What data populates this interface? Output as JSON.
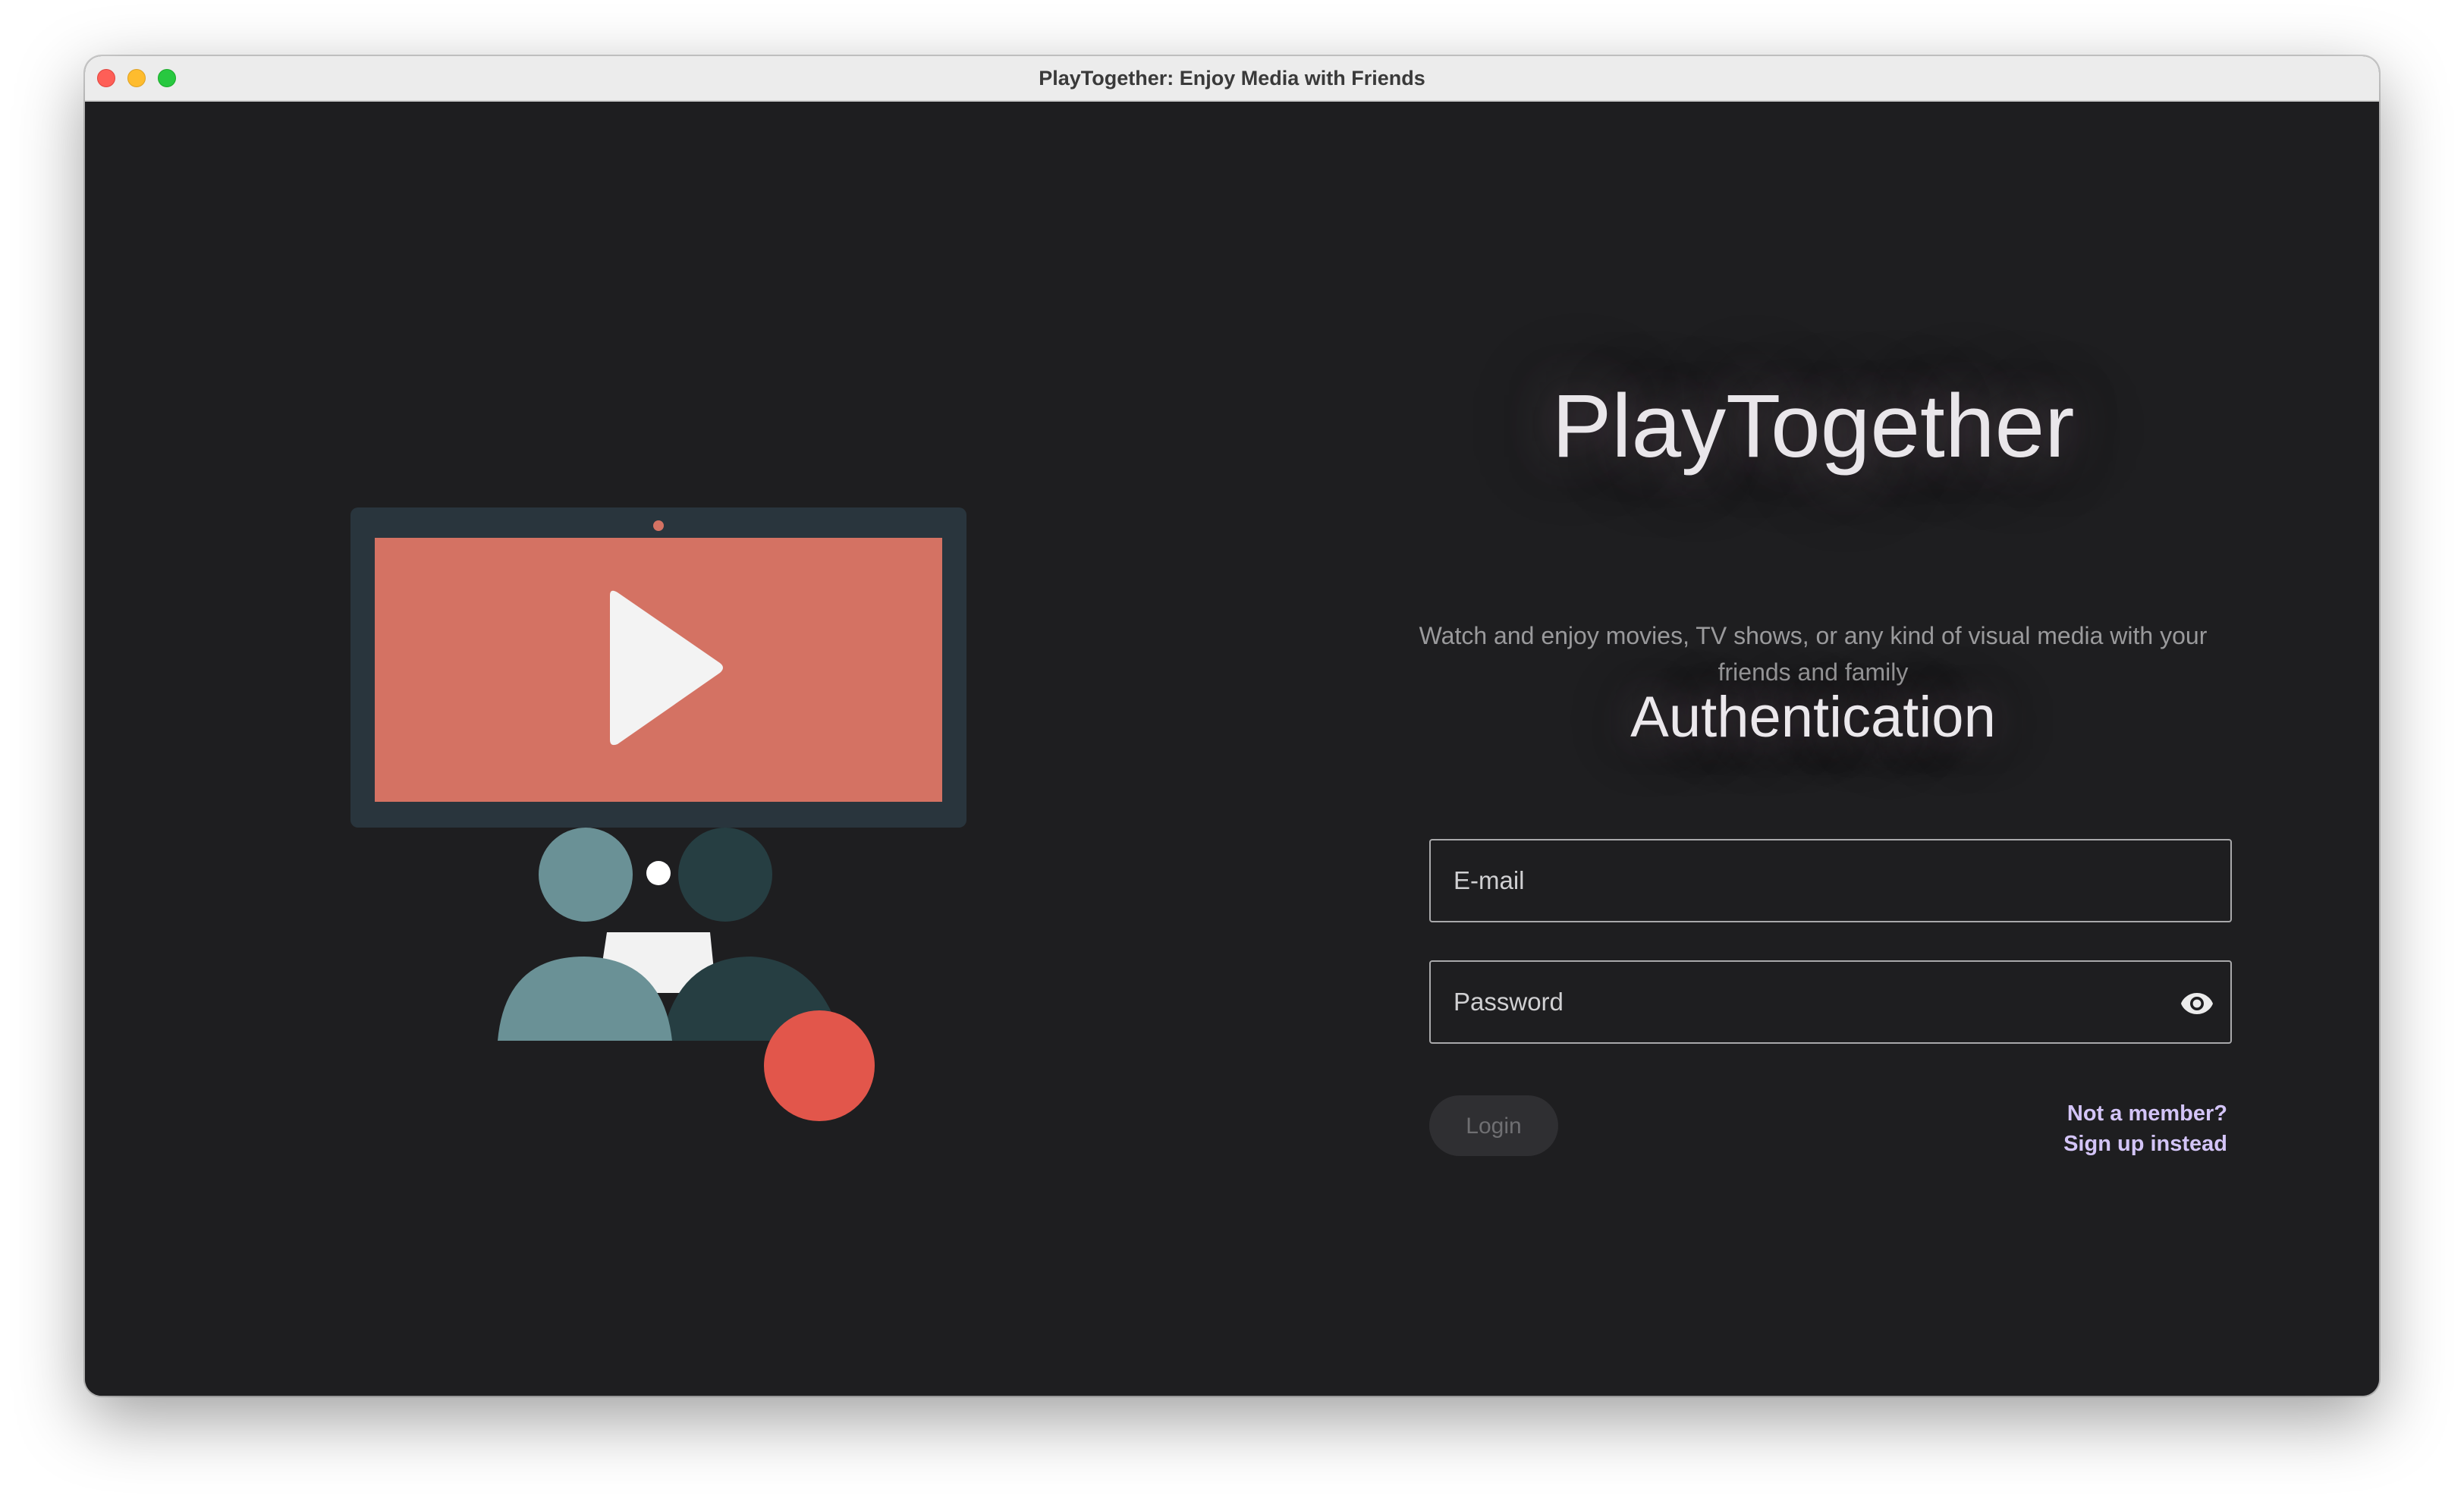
{
  "window": {
    "title": "PlayTogether: Enjoy Media with Friends"
  },
  "hero": {
    "app_name": "PlayTogether",
    "tagline": "Watch and enjoy movies, TV shows, or any kind of visual media with your friends and family",
    "section_title": "Authentication"
  },
  "form": {
    "email_placeholder": "E-mail",
    "password_placeholder": "Password",
    "password_toggle_icon": "eye-icon",
    "login_label": "Login",
    "signup_line1": "Not a member?",
    "signup_line2": "Sign up instead"
  },
  "colors": {
    "background": "#1e1e20",
    "screen": "#d47263",
    "monitor_frame": "#29353d",
    "person_light": "#6a9196",
    "person_dark": "#263e42",
    "accent_circle": "#e2564b",
    "link": "#d3c4f7"
  }
}
